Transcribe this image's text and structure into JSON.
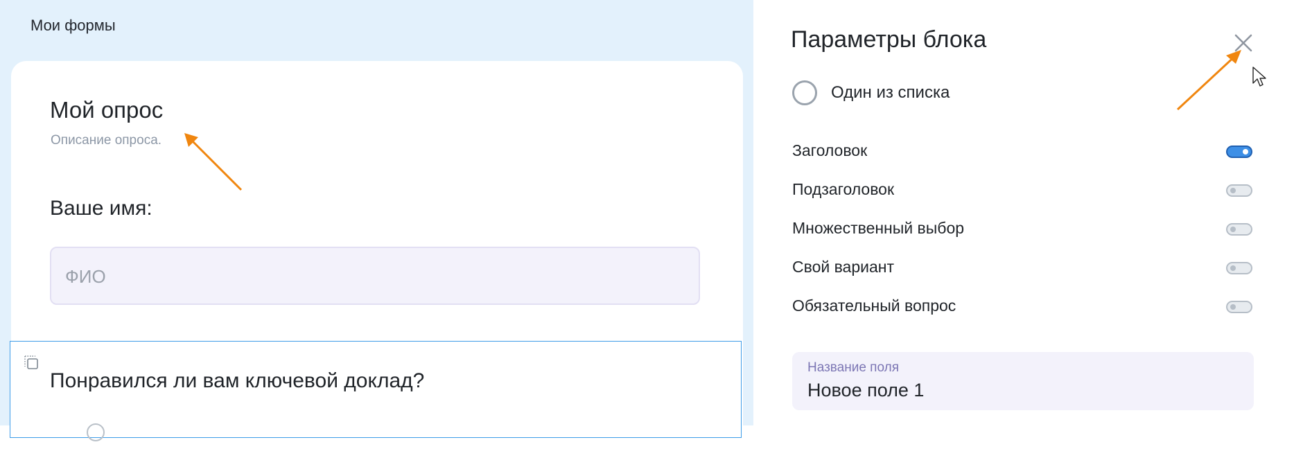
{
  "breadcrumb": "Мои формы",
  "form": {
    "title": "Мой опрос",
    "description": "Описание опроса.",
    "question1": "Ваше имя:",
    "question1_placeholder": "ФИО",
    "question2": "Понравился ли вам ключевой доклад?"
  },
  "panel": {
    "title": "Параметры блока",
    "block_type": "Один из списка",
    "toggles": [
      {
        "label": "Заголовок",
        "on": true
      },
      {
        "label": "Подзаголовок",
        "on": false
      },
      {
        "label": "Множественный выбор",
        "on": false
      },
      {
        "label": "Свой вариант",
        "on": false
      },
      {
        "label": "Обязательный вопрос",
        "on": false
      }
    ],
    "field_name_label": "Название поля",
    "field_name_value": "Новое поле 1"
  },
  "icons": {
    "close": "close-icon",
    "drag": "drag-handle-icon",
    "cursor": "mouse-cursor-icon",
    "annotation": "orange-arrow"
  },
  "colors": {
    "background_left": "#e3f1fc",
    "toggle_on": "#3d8fe6",
    "selected_border": "#3c9be8",
    "annotation_arrow": "#f0860f"
  }
}
